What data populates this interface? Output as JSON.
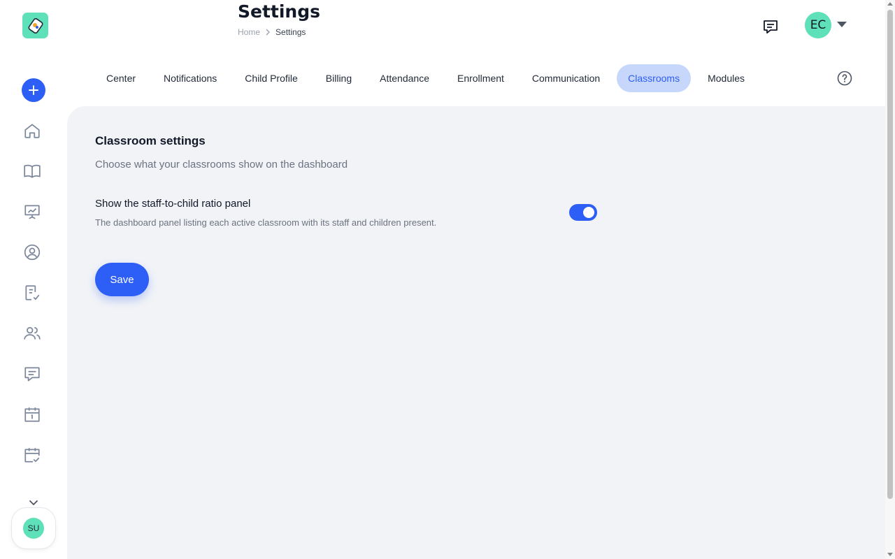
{
  "colors": {
    "accent": "#2d5ef5",
    "accent_light": "#c7d6fb",
    "avatar_green": "#5ee0b8",
    "content_bg": "#f1f3f7"
  },
  "sidebar": {
    "logo_icon": "app-logo",
    "add_icon": "plus-icon",
    "items": [
      {
        "icon": "home-icon"
      },
      {
        "icon": "book-icon"
      },
      {
        "icon": "presentation-icon"
      },
      {
        "icon": "profile-icon"
      },
      {
        "icon": "checklist-icon"
      },
      {
        "icon": "users-icon"
      },
      {
        "icon": "message-icon"
      },
      {
        "icon": "calendar-icon"
      },
      {
        "icon": "calendar-check-icon"
      }
    ],
    "more_icon": "chevron-down-icon",
    "user_initials": "SU"
  },
  "header": {
    "title": "Settings",
    "breadcrumb": {
      "home": "Home",
      "separator": ">",
      "current": "Settings"
    },
    "user_initials": "EC"
  },
  "tabs": [
    {
      "label": "Center",
      "active": false
    },
    {
      "label": "Notifications",
      "active": false
    },
    {
      "label": "Child Profile",
      "active": false
    },
    {
      "label": "Billing",
      "active": false
    },
    {
      "label": "Attendance",
      "active": false
    },
    {
      "label": "Enrollment",
      "active": false
    },
    {
      "label": "Communication",
      "active": false
    },
    {
      "label": "Classrooms",
      "active": true
    },
    {
      "label": "Modules",
      "active": false
    }
  ],
  "classroom_settings": {
    "title": "Classroom settings",
    "subtitle": "Choose what your classrooms show on the dashboard",
    "ratio_panel": {
      "label": "Show the staff-to-child ratio panel",
      "description": "The dashboard panel listing each active classroom with its staff and children present.",
      "enabled": true
    },
    "save_label": "Save"
  }
}
